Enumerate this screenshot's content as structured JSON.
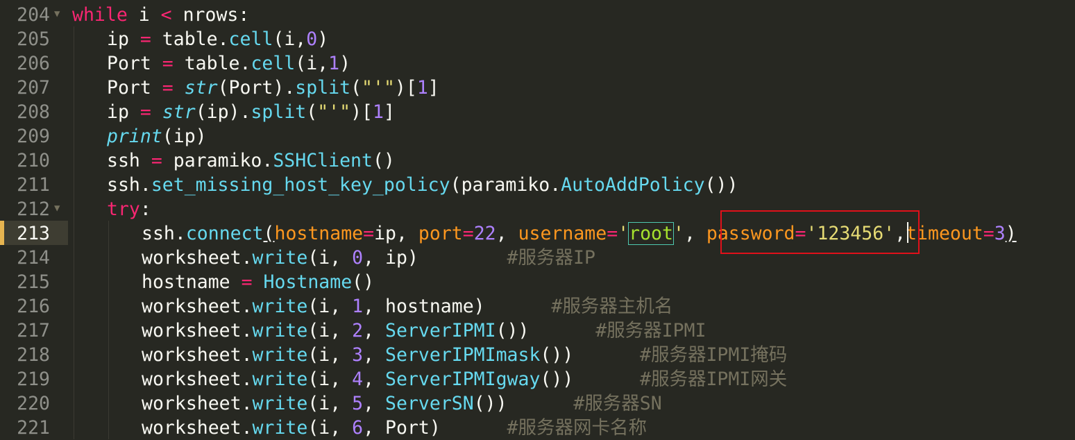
{
  "editor": {
    "language": "Python",
    "current_line": "213",
    "colors": {
      "background": "#272822",
      "keyword": "#f92672",
      "function": "#66d9ef",
      "number": "#ae81ff",
      "string": "#e6db74",
      "argument": "#fd971f",
      "comment": "#75715e",
      "highlight_box": "#e0101a"
    },
    "lines": [
      {
        "num": "204",
        "fold": true,
        "indent": 0,
        "tokens": [
          [
            "kw",
            "while"
          ],
          [
            "t",
            " i "
          ],
          [
            "op",
            "<"
          ],
          [
            "t",
            " nrows:"
          ]
        ]
      },
      {
        "num": "205",
        "indent": 1,
        "tokens": [
          [
            "t",
            "ip "
          ],
          [
            "op",
            "="
          ],
          [
            "t",
            " table."
          ],
          [
            "fn",
            "cell"
          ],
          [
            "t",
            "(i,"
          ],
          [
            "num",
            "0"
          ],
          [
            "t",
            ")"
          ]
        ]
      },
      {
        "num": "206",
        "indent": 1,
        "tokens": [
          [
            "t",
            "Port "
          ],
          [
            "op",
            "="
          ],
          [
            "t",
            " table."
          ],
          [
            "fn",
            "cell"
          ],
          [
            "t",
            "(i,"
          ],
          [
            "num",
            "1"
          ],
          [
            "t",
            ")"
          ]
        ]
      },
      {
        "num": "207",
        "indent": 1,
        "tokens": [
          [
            "t",
            "Port "
          ],
          [
            "op",
            "="
          ],
          [
            "t",
            " "
          ],
          [
            "bi",
            "str"
          ],
          [
            "t",
            "(Port)."
          ],
          [
            "fn",
            "split"
          ],
          [
            "t",
            "("
          ],
          [
            "str",
            "\"'\""
          ],
          [
            "t",
            ")["
          ],
          [
            "num",
            "1"
          ],
          [
            "t",
            "]"
          ]
        ]
      },
      {
        "num": "208",
        "indent": 1,
        "tokens": [
          [
            "t",
            "ip "
          ],
          [
            "op",
            "="
          ],
          [
            "t",
            " "
          ],
          [
            "bi",
            "str"
          ],
          [
            "t",
            "(ip)."
          ],
          [
            "fn",
            "split"
          ],
          [
            "t",
            "("
          ],
          [
            "str",
            "\"'\""
          ],
          [
            "t",
            ")["
          ],
          [
            "num",
            "1"
          ],
          [
            "t",
            "]"
          ]
        ]
      },
      {
        "num": "209",
        "indent": 1,
        "tokens": [
          [
            "bi",
            "print"
          ],
          [
            "t",
            "(ip)"
          ]
        ]
      },
      {
        "num": "210",
        "indent": 1,
        "tokens": [
          [
            "t",
            "ssh "
          ],
          [
            "op",
            "="
          ],
          [
            "t",
            " paramiko."
          ],
          [
            "fn",
            "SSHClient"
          ],
          [
            "t",
            "()"
          ]
        ]
      },
      {
        "num": "211",
        "indent": 1,
        "tokens": [
          [
            "t",
            "ssh."
          ],
          [
            "fn",
            "set_missing_host_key_policy"
          ],
          [
            "t",
            "(paramiko."
          ],
          [
            "fn",
            "AutoAddPolicy"
          ],
          [
            "t",
            "())"
          ]
        ]
      },
      {
        "num": "212",
        "fold": true,
        "indent": 1,
        "tokens": [
          [
            "kw",
            "try"
          ],
          [
            "t",
            ":"
          ]
        ]
      },
      {
        "num": "213",
        "indent": 2,
        "current": true,
        "tokens": [
          [
            "t",
            "ssh."
          ],
          [
            "fn",
            "connect"
          ],
          [
            "und",
            "("
          ],
          [
            "arg",
            "hostname"
          ],
          [
            "op",
            "="
          ],
          [
            "t",
            "ip, "
          ],
          [
            "arg",
            "port"
          ],
          [
            "op",
            "="
          ],
          [
            "num",
            "22"
          ],
          [
            "t",
            ", "
          ],
          [
            "arg",
            "username"
          ],
          [
            "op",
            "="
          ],
          [
            "str",
            "'"
          ],
          [
            "hl",
            "root"
          ],
          [
            "str",
            "'"
          ],
          [
            "t",
            ", "
          ],
          [
            "arg",
            "password"
          ],
          [
            "op",
            "="
          ],
          [
            "str",
            "'123456'"
          ],
          [
            "t",
            ","
          ],
          [
            "arg",
            "timeout"
          ],
          [
            "op",
            "="
          ],
          [
            "num",
            "3"
          ],
          [
            "und",
            ")"
          ]
        ]
      },
      {
        "num": "214",
        "indent": 2,
        "tokens": [
          [
            "t",
            "worksheet."
          ],
          [
            "fn",
            "write"
          ],
          [
            "t",
            "(i, "
          ],
          [
            "num",
            "0"
          ],
          [
            "t",
            ", ip)        "
          ],
          [
            "cmt",
            "#服务器IP"
          ]
        ]
      },
      {
        "num": "215",
        "indent": 2,
        "tokens": [
          [
            "t",
            "hostname "
          ],
          [
            "op",
            "="
          ],
          [
            "t",
            " "
          ],
          [
            "fn",
            "Hostname"
          ],
          [
            "t",
            "()"
          ]
        ]
      },
      {
        "num": "216",
        "indent": 2,
        "tokens": [
          [
            "t",
            "worksheet."
          ],
          [
            "fn",
            "write"
          ],
          [
            "t",
            "(i, "
          ],
          [
            "num",
            "1"
          ],
          [
            "t",
            ", hostname)      "
          ],
          [
            "cmt",
            "#服务器主机名"
          ]
        ]
      },
      {
        "num": "217",
        "indent": 2,
        "tokens": [
          [
            "t",
            "worksheet."
          ],
          [
            "fn",
            "write"
          ],
          [
            "t",
            "(i, "
          ],
          [
            "num",
            "2"
          ],
          [
            "t",
            ", "
          ],
          [
            "fn",
            "ServerIPMI"
          ],
          [
            "t",
            "())      "
          ],
          [
            "cmt",
            "#服务器IPMI"
          ]
        ]
      },
      {
        "num": "218",
        "indent": 2,
        "tokens": [
          [
            "t",
            "worksheet."
          ],
          [
            "fn",
            "write"
          ],
          [
            "t",
            "(i, "
          ],
          [
            "num",
            "3"
          ],
          [
            "t",
            ", "
          ],
          [
            "fn",
            "ServerIPMImask"
          ],
          [
            "t",
            "())      "
          ],
          [
            "cmt",
            "#服务器IPMI掩码"
          ]
        ]
      },
      {
        "num": "219",
        "indent": 2,
        "tokens": [
          [
            "t",
            "worksheet."
          ],
          [
            "fn",
            "write"
          ],
          [
            "t",
            "(i, "
          ],
          [
            "num",
            "4"
          ],
          [
            "t",
            ", "
          ],
          [
            "fn",
            "ServerIPMIgway"
          ],
          [
            "t",
            "())      "
          ],
          [
            "cmt",
            "#服务器IPMI网关"
          ]
        ]
      },
      {
        "num": "220",
        "indent": 2,
        "tokens": [
          [
            "t",
            "worksheet."
          ],
          [
            "fn",
            "write"
          ],
          [
            "t",
            "(i, "
          ],
          [
            "num",
            "5"
          ],
          [
            "t",
            ", "
          ],
          [
            "fn",
            "ServerSN"
          ],
          [
            "t",
            "())      "
          ],
          [
            "cmt",
            "#服务器SN"
          ]
        ]
      },
      {
        "num": "221",
        "indent": 2,
        "tokens": [
          [
            "t",
            "worksheet."
          ],
          [
            "fn",
            "write"
          ],
          [
            "t",
            "(i, "
          ],
          [
            "num",
            "6"
          ],
          [
            "t",
            ", Port)      "
          ],
          [
            "cmt",
            "#服务器网卡名称"
          ]
        ]
      }
    ]
  }
}
